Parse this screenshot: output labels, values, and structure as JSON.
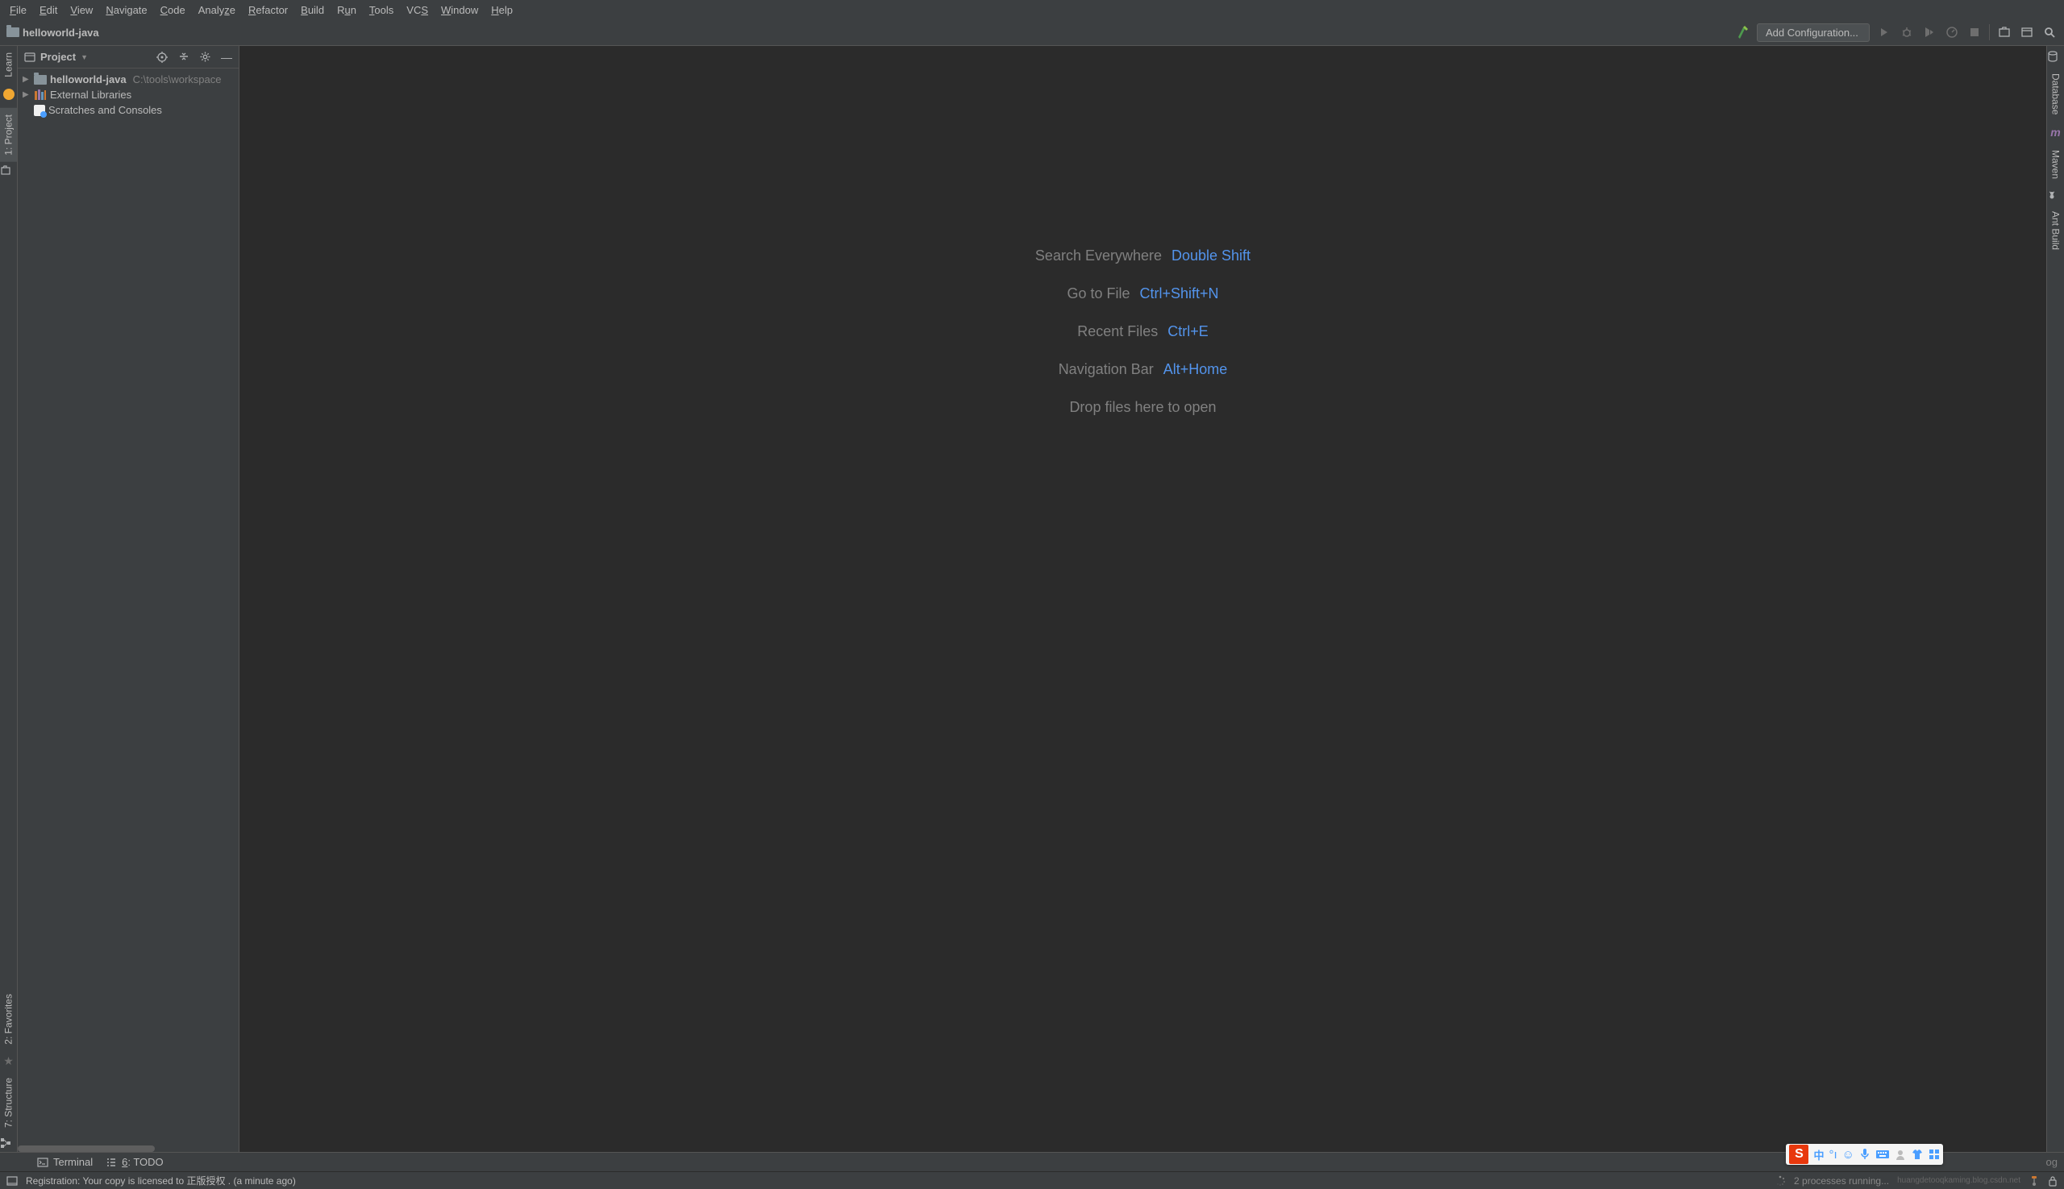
{
  "menubar": {
    "file": "File",
    "edit": "Edit",
    "view": "View",
    "navigate": "Navigate",
    "code": "Code",
    "analyze": "Analyze",
    "refactor": "Refactor",
    "build": "Build",
    "run": "Run",
    "tools": "Tools",
    "vcs": "VCS",
    "window": "Window",
    "help": "Help"
  },
  "breadcrumb": {
    "project": "helloworld-java"
  },
  "toolbar": {
    "config_label": "Add Configuration..."
  },
  "project_panel": {
    "title": "Project",
    "tree": {
      "root": {
        "name": "helloworld-java",
        "path": "C:\\tools\\workspace"
      },
      "libs": "External Libraries",
      "scratches": "Scratches and Consoles"
    }
  },
  "left_tabs": {
    "learn": "Learn",
    "project": "1: Project",
    "favorites": "2: Favorites",
    "structure": "7: Structure"
  },
  "right_tabs": {
    "database": "Database",
    "maven": "Maven",
    "ant": "Ant Build"
  },
  "editor_hints": [
    {
      "label": "Search Everywhere",
      "key": "Double Shift"
    },
    {
      "label": "Go to File",
      "key": "Ctrl+Shift+N"
    },
    {
      "label": "Recent Files",
      "key": "Ctrl+E"
    },
    {
      "label": "Navigation Bar",
      "key": "Alt+Home"
    },
    {
      "label": "Drop files here to open",
      "key": ""
    }
  ],
  "bottom_tabs": {
    "terminal": "Terminal",
    "todo_num": "6",
    "todo_text": ": TODO",
    "eventlog": "og"
  },
  "status": {
    "registration": "Registration: Your copy is licensed to 正版授权 . (a minute ago)",
    "processes": "2 processes running...",
    "watermark": "huangdetooqkaming.blog.csdn.net"
  },
  "ime": {
    "logo": "S",
    "cn": "中"
  }
}
